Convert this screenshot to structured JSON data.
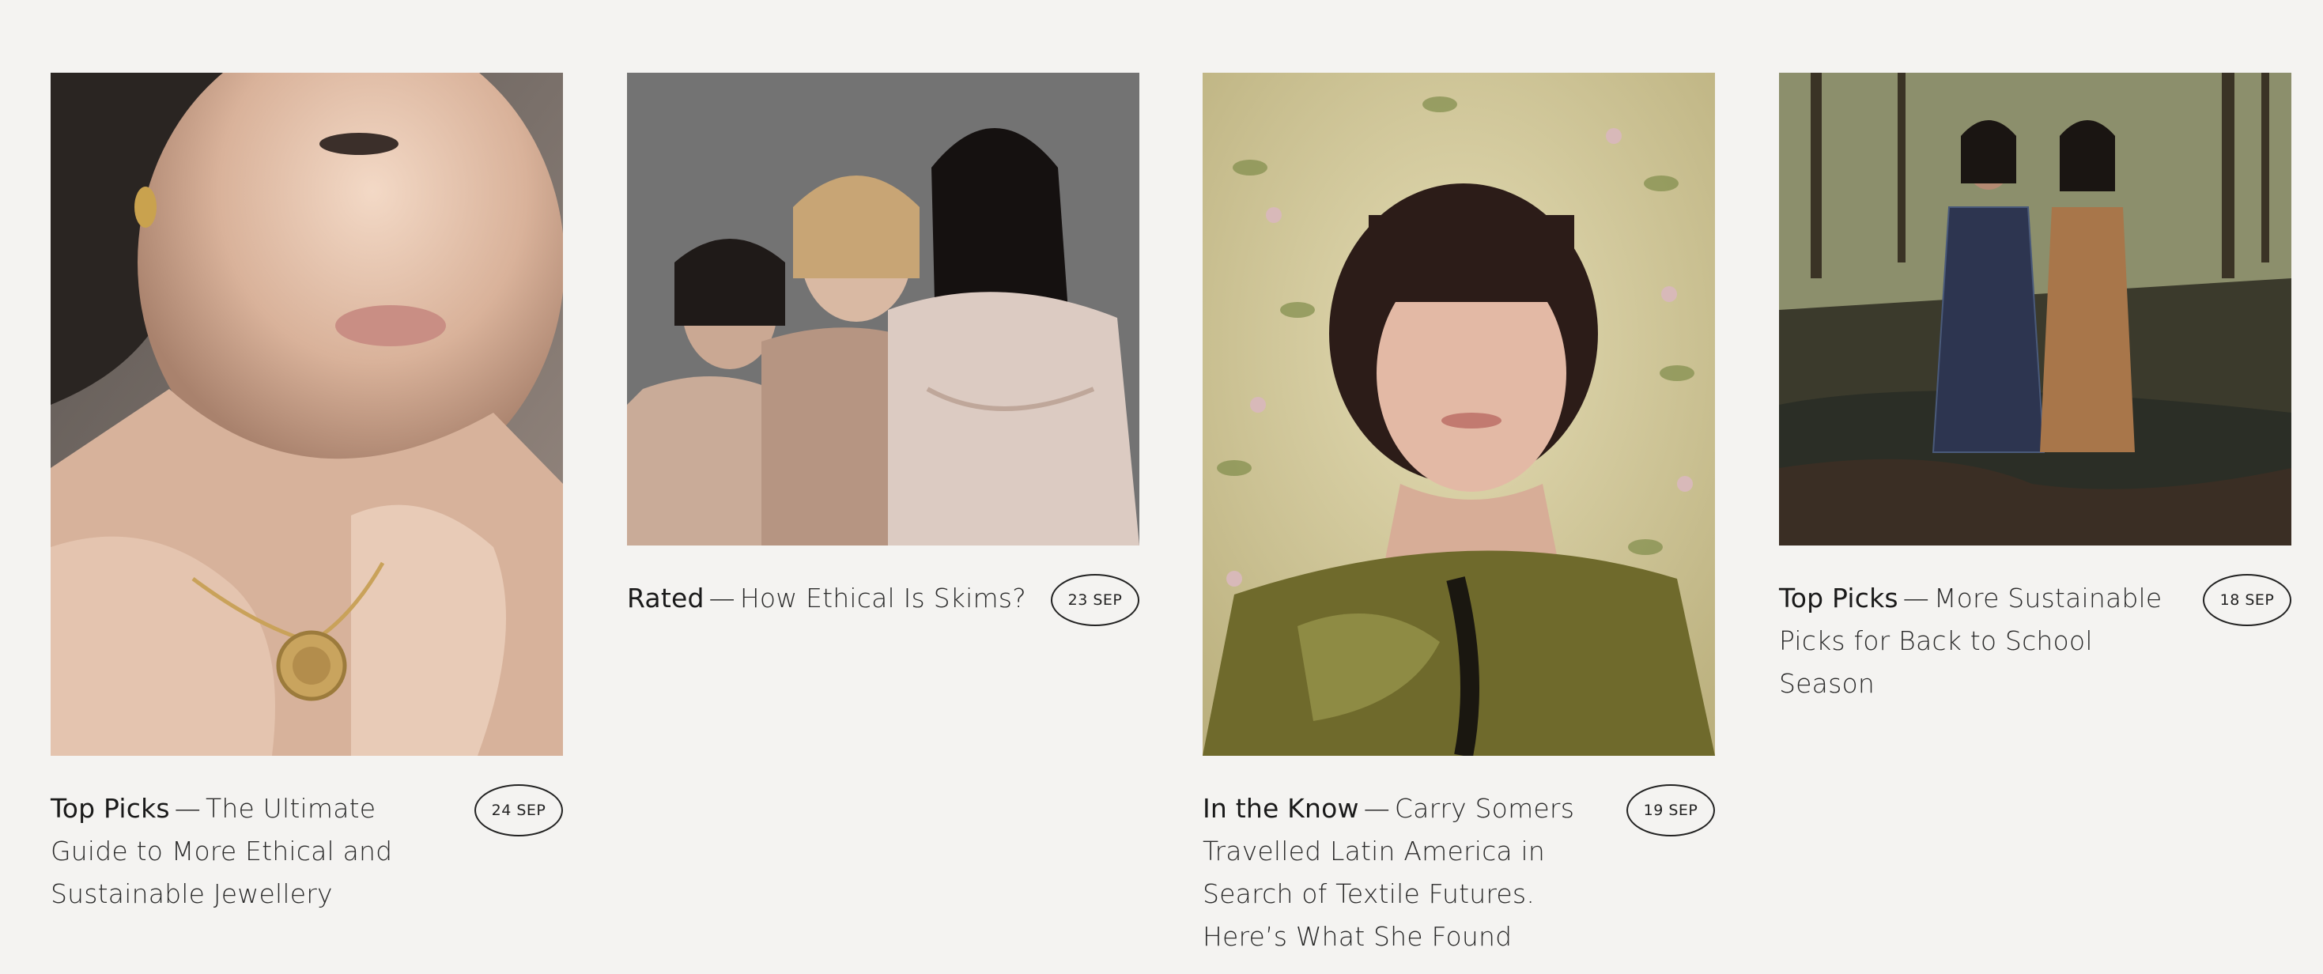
{
  "articles": [
    {
      "category": "Top Picks",
      "title": "The Ultimate Guide to More Ethical and Sustainable Jewellery",
      "date": "24 SEP",
      "image": "woman-holding-gold-medallion-necklace"
    },
    {
      "category": "Rated",
      "title": "How Ethical Is Skims?",
      "date": "23 SEP",
      "image": "three-women-in-nude-shapewear"
    },
    {
      "category": "In the Know",
      "title": "Carry Somers Travelled Latin America in Search of Textile Futures. Here’s What She Found",
      "date": "19 SEP",
      "image": "portrait-woman-floral-wallpaper"
    },
    {
      "category": "Top Picks",
      "title": "More Sustainable Picks for Back to School Season",
      "date": "18 SEP",
      "image": "two-women-in-dresses-by-forest-creek"
    }
  ],
  "separator": "—"
}
